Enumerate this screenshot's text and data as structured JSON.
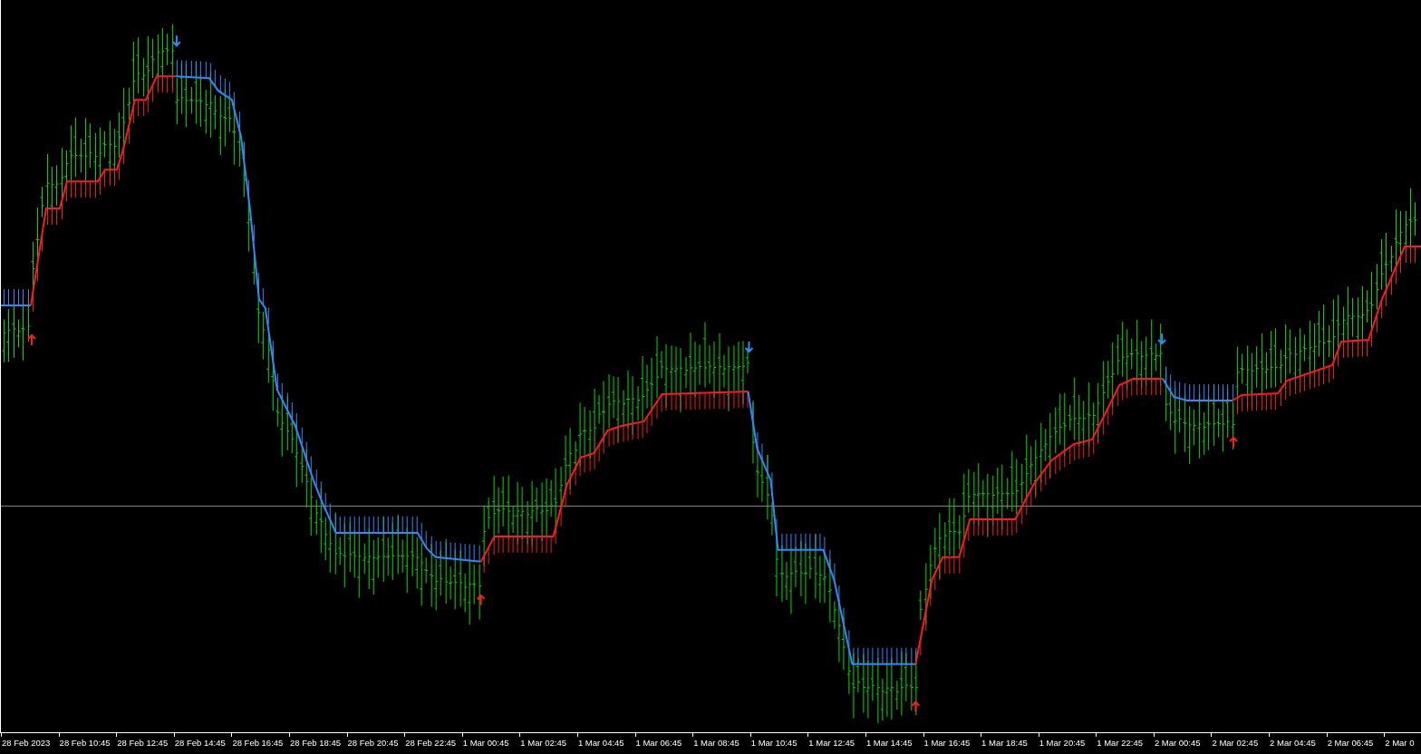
{
  "time_axis": {
    "labels": [
      "28 Feb 2023",
      "28 Feb 10:45",
      "28 Feb 12:45",
      "28 Feb 14:45",
      "28 Feb 16:45",
      "28 Feb 18:45",
      "28 Feb 20:45",
      "28 Feb 22:45",
      "1 Mar 00:45",
      "1 Mar 02:45",
      "1 Mar 04:45",
      "1 Mar 06:45",
      "1 Mar 08:45",
      "1 Mar 10:45",
      "1 Mar 12:45",
      "1 Mar 14:45",
      "1 Mar 16:45",
      "1 Mar 18:45",
      "1 Mar 20:45",
      "1 Mar 22:45",
      "2 Mar 00:45",
      "2 Mar 02:45",
      "2 Mar 04:45",
      "2 Mar 06:45",
      "2 Mar 0"
    ]
  }
}
